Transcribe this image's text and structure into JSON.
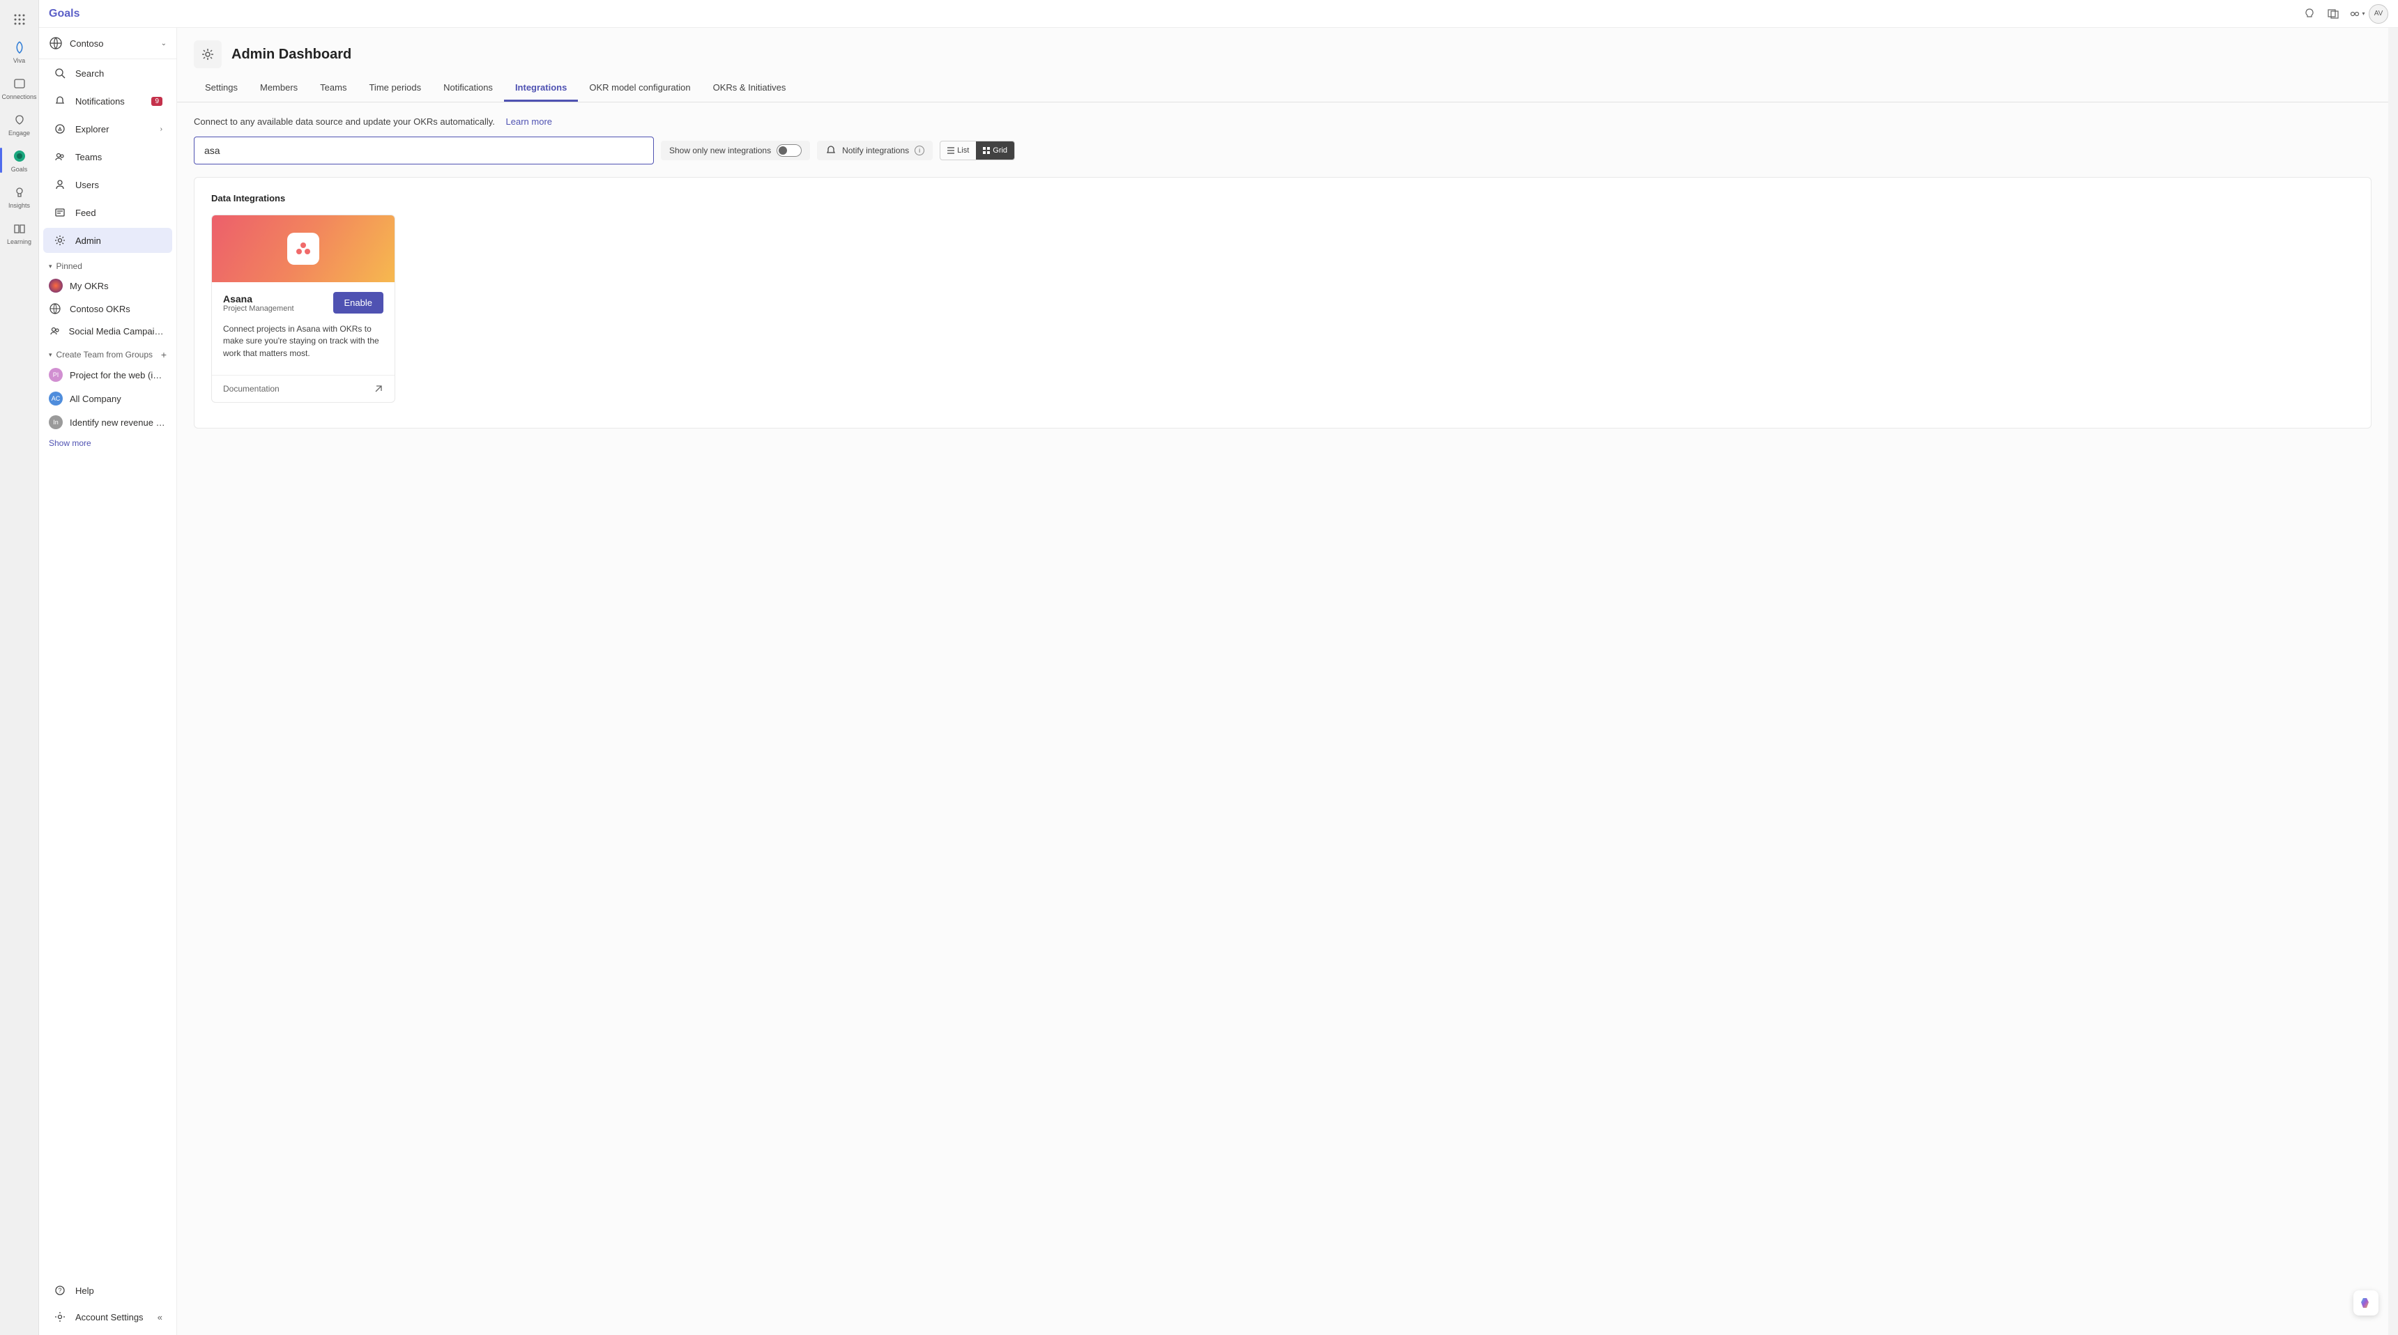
{
  "brand": "Goals",
  "header": {
    "avatar_initials": "AV"
  },
  "rail": {
    "items": [
      {
        "label": "Viva"
      },
      {
        "label": "Connections"
      },
      {
        "label": "Engage"
      },
      {
        "label": "Goals"
      },
      {
        "label": "Insights"
      },
      {
        "label": "Learning"
      }
    ],
    "active_index": 3
  },
  "sidebar": {
    "tenant": "Contoso",
    "nav": [
      {
        "label": "Search"
      },
      {
        "label": "Notifications",
        "badge": "9"
      },
      {
        "label": "Explorer",
        "has_chevron": true
      },
      {
        "label": "Teams"
      },
      {
        "label": "Users"
      },
      {
        "label": "Feed"
      },
      {
        "label": "Admin",
        "active": true
      }
    ],
    "pinned_label": "Pinned",
    "pinned": [
      {
        "label": "My OKRs",
        "color": "radial"
      },
      {
        "label": "Contoso OKRs",
        "icon": "globe"
      },
      {
        "label": "Social Media Campaign…",
        "icon": "people"
      }
    ],
    "groups_label": "Create Team from Groups",
    "groups": [
      {
        "label": "Project for the web (i…",
        "initials": "PI",
        "bg": "#d18fd1"
      },
      {
        "label": "All Company",
        "initials": "AC",
        "bg": "#4f8ddc"
      },
      {
        "label": "Identify new revenue …",
        "initials": "In",
        "bg": "#9a9a9a"
      }
    ],
    "show_more": "Show more",
    "help": "Help",
    "account_settings": "Account Settings"
  },
  "page": {
    "title": "Admin Dashboard",
    "tabs": [
      "Settings",
      "Members",
      "Teams",
      "Time periods",
      "Notifications",
      "Integrations",
      "OKR model configuration",
      "OKRs & Initiatives"
    ],
    "active_tab": 5,
    "subhead": "Connect to any available data source and update your OKRs automatically.",
    "learn_more": "Learn more",
    "search_value": "asa",
    "show_new_label": "Show only new integrations",
    "notify_label": "Notify integrations",
    "view_list": "List",
    "view_grid": "Grid",
    "panel_title": "Data Integrations"
  },
  "card": {
    "name": "Asana",
    "subtitle": "Project Management",
    "enable_label": "Enable",
    "description": "Connect projects in Asana with OKRs to make sure you're staying on track with the work that matters most.",
    "doc_label": "Documentation"
  }
}
